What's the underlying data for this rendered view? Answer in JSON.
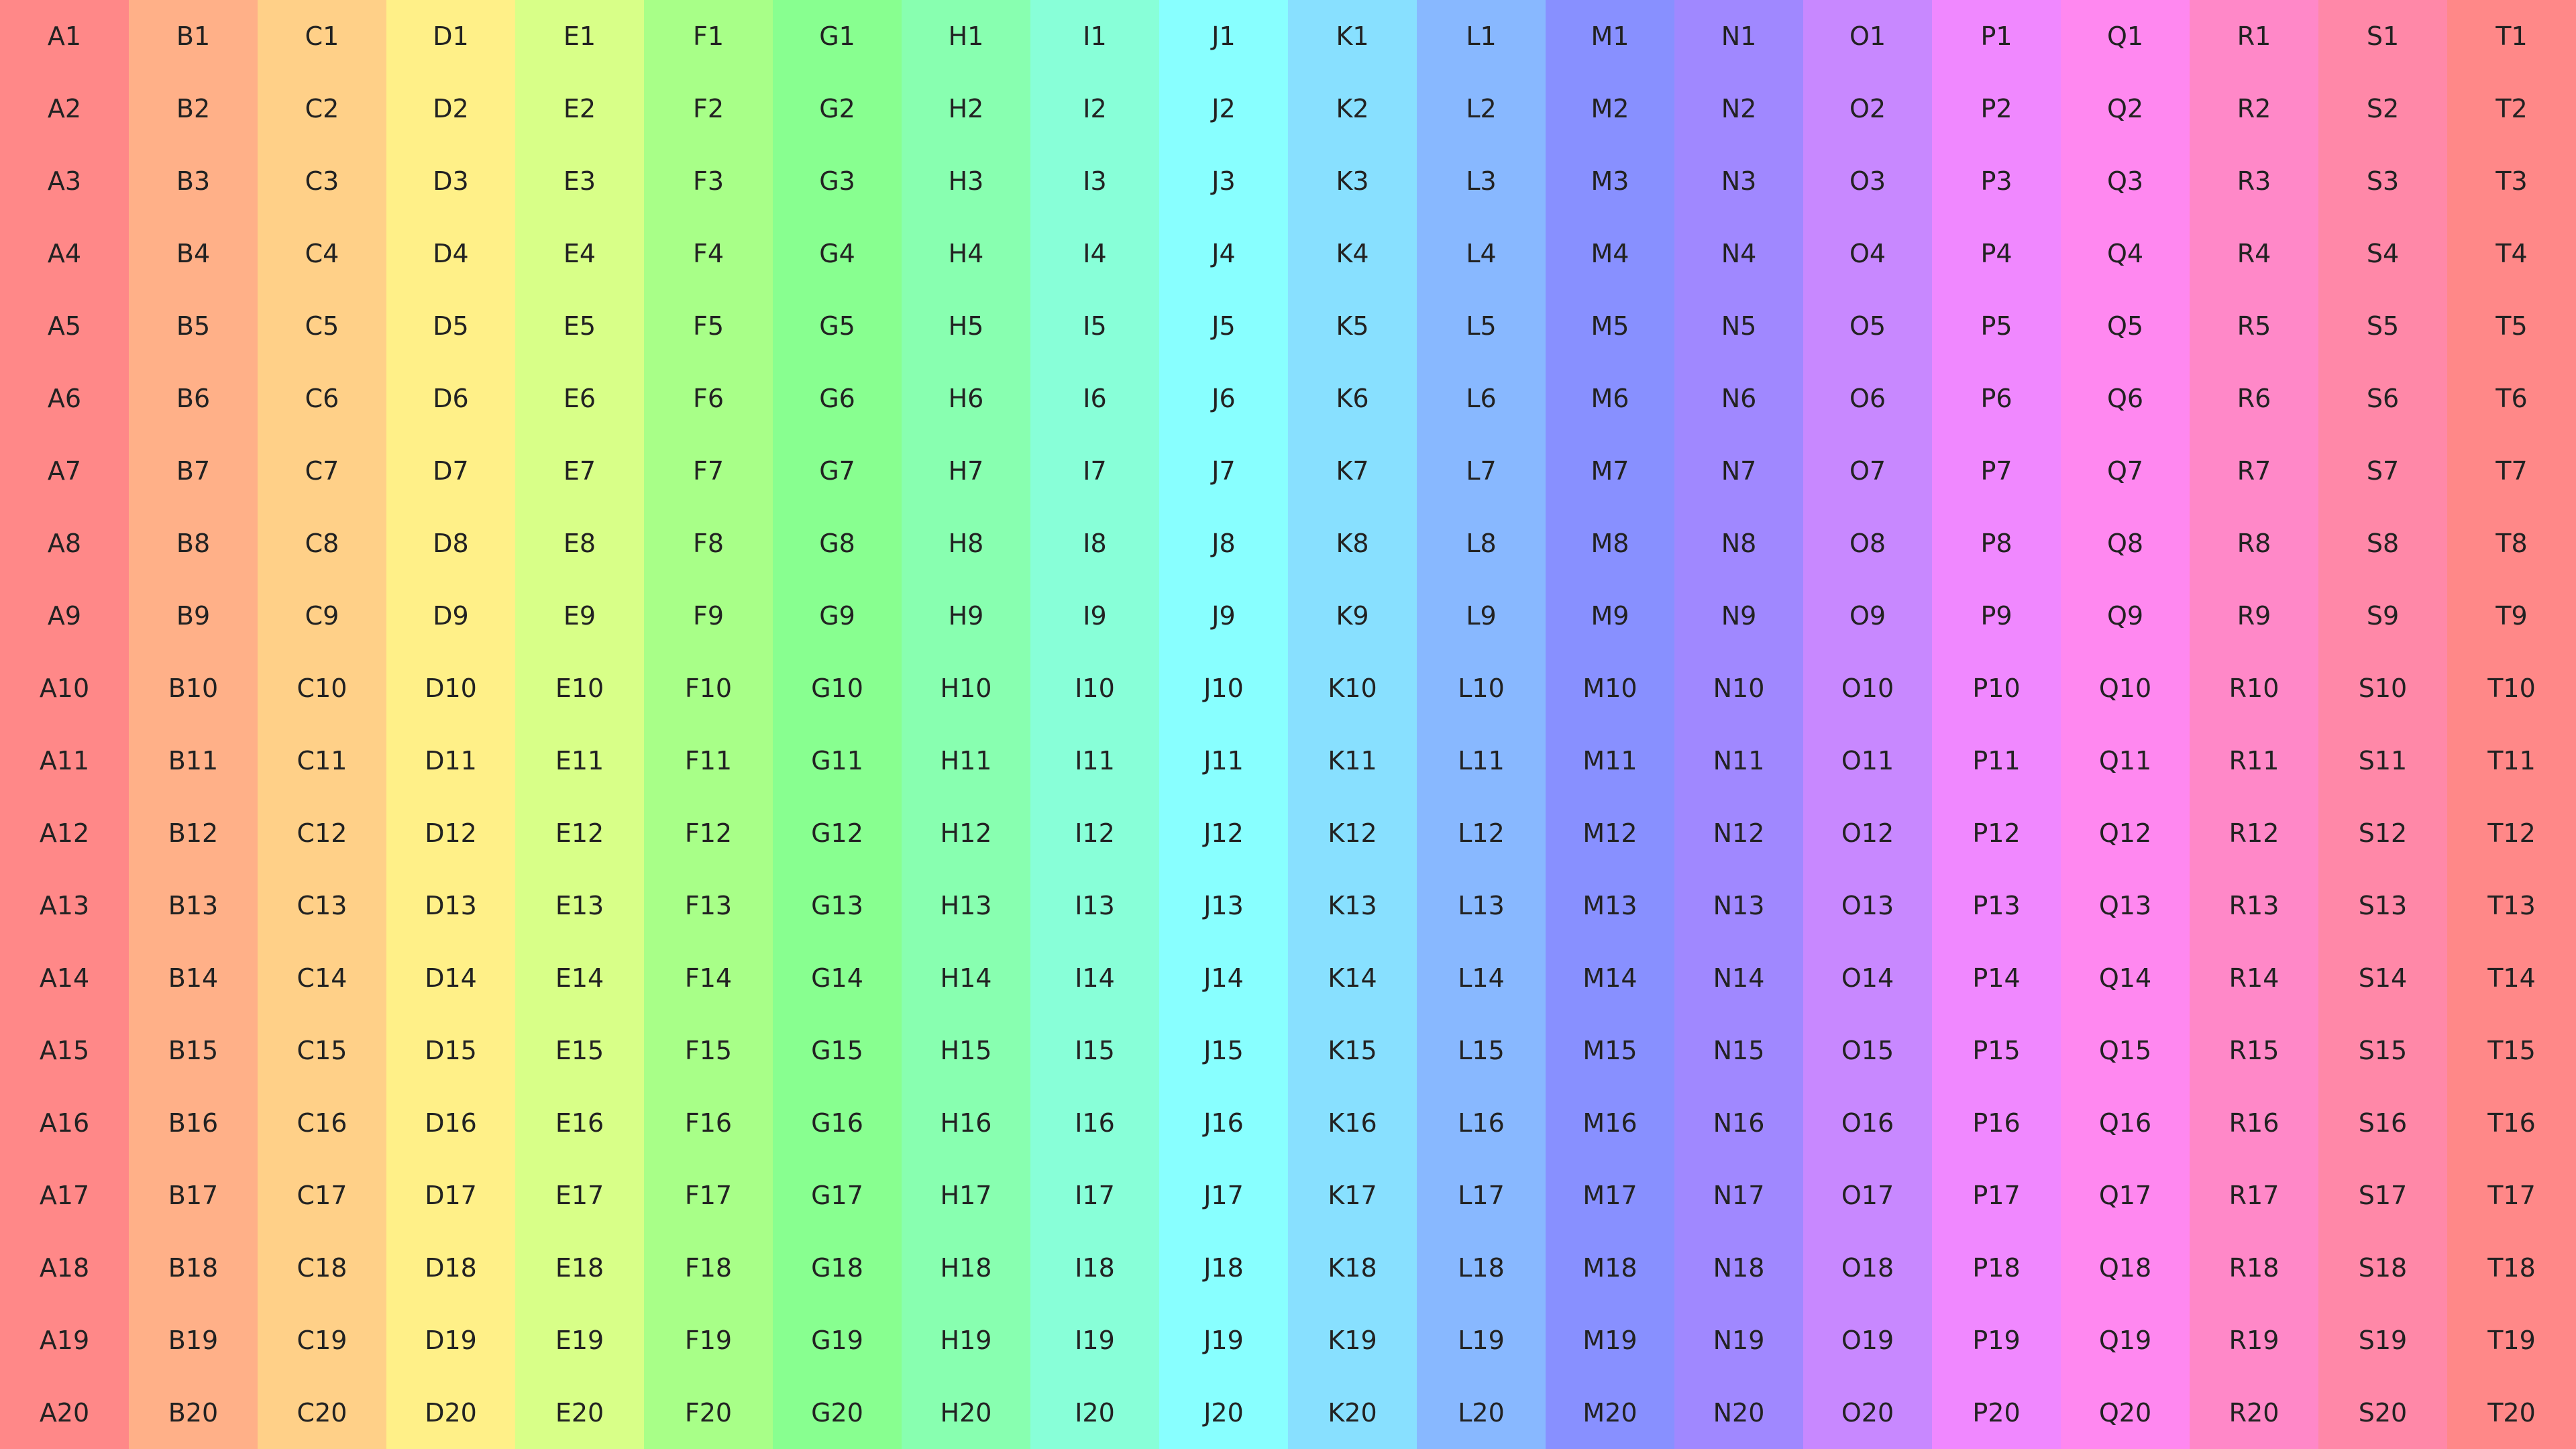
{
  "columns": [
    {
      "letter": "A",
      "color": "#ff8888"
    },
    {
      "letter": "B",
      "color": "#ffb088"
    },
    {
      "letter": "C",
      "color": "#ffd088"
    },
    {
      "letter": "D",
      "color": "#fff088"
    },
    {
      "letter": "E",
      "color": "#d8ff88"
    },
    {
      "letter": "F",
      "color": "#a8ff88"
    },
    {
      "letter": "G",
      "color": "#88ff90"
    },
    {
      "letter": "H",
      "color": "#88ffb0"
    },
    {
      "letter": "I",
      "color": "#88ffd8"
    },
    {
      "letter": "J",
      "color": "#88ffff"
    },
    {
      "letter": "K",
      "color": "#88e0ff"
    },
    {
      "letter": "L",
      "color": "#88b8ff"
    },
    {
      "letter": "M",
      "color": "#8890ff"
    },
    {
      "letter": "N",
      "color": "#a088ff"
    },
    {
      "letter": "O",
      "color": "#c888ff"
    },
    {
      "letter": "P",
      "color": "#f088ff"
    },
    {
      "letter": "Q",
      "color": "#ff88f0"
    },
    {
      "letter": "R",
      "color": "#ff88c8"
    },
    {
      "letter": "S",
      "color": "#ff88a8"
    },
    {
      "letter": "T",
      "color": "#ff8888"
    }
  ],
  "rows": [
    "1",
    "2",
    "3",
    "4",
    "5",
    "6",
    "7",
    "8",
    "9",
    "10",
    "11",
    "12",
    "13",
    "14",
    "15",
    "16",
    "17",
    "18",
    "19",
    "20"
  ]
}
